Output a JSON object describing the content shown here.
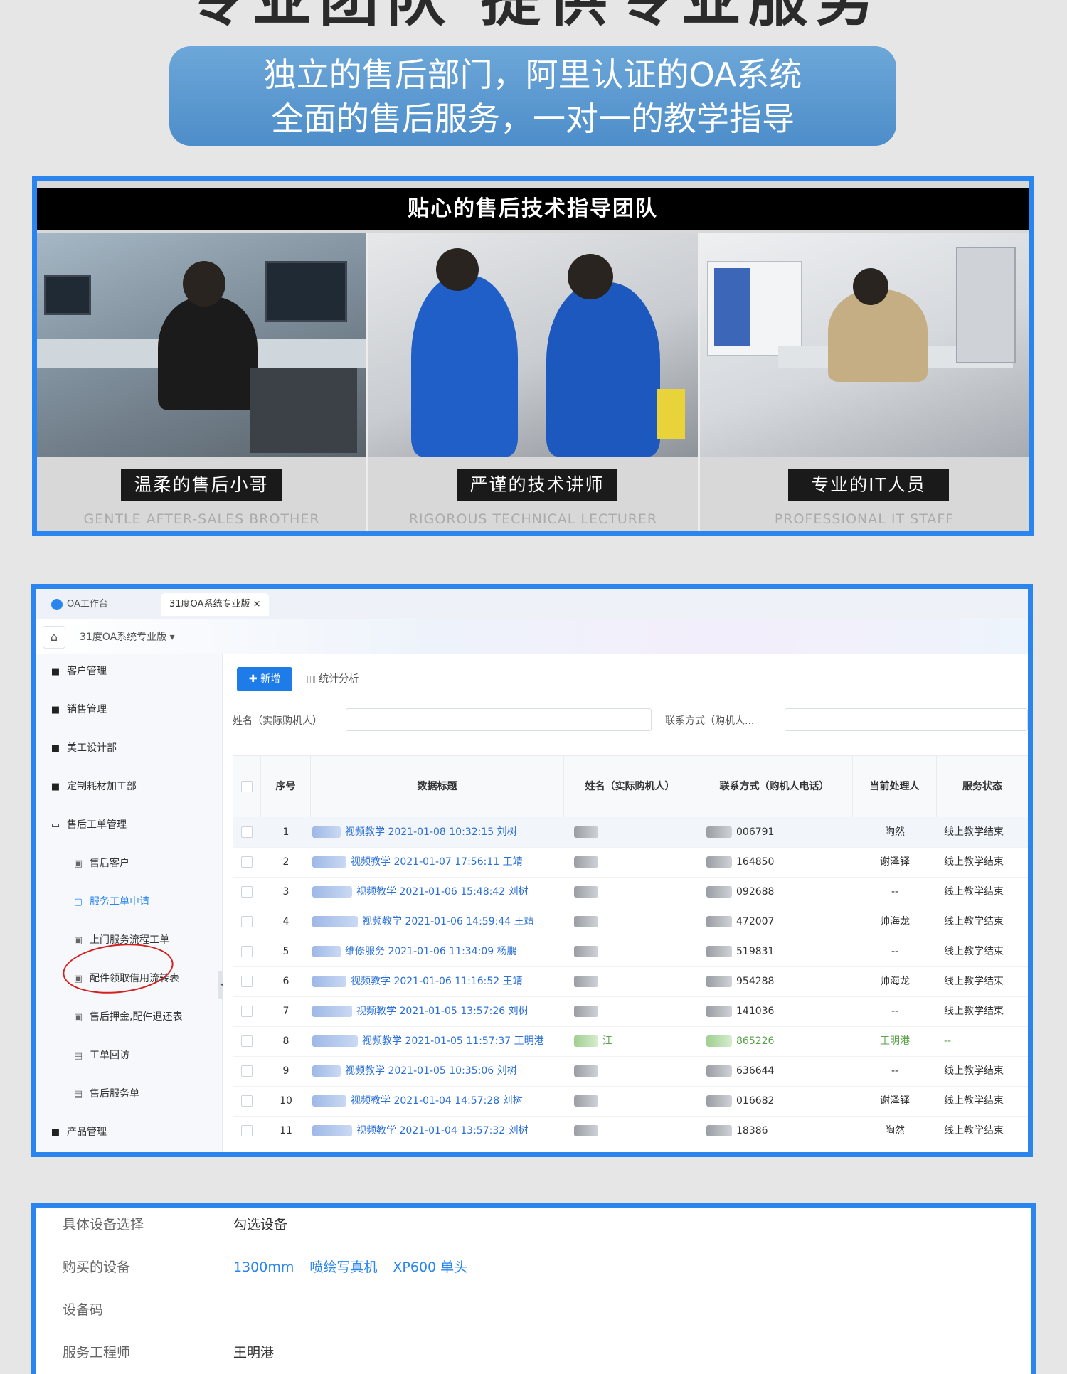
{
  "hero": {
    "title": "专业团队 提供专业服务",
    "line1": "独立的售后部门，阿里认证的OA系统",
    "line2": "全面的售后服务，一对一的教学指导"
  },
  "team": {
    "header": "贴心的售后技术指导团队",
    "members": [
      {
        "cn": "温柔的售后小哥",
        "en": "GENTLE AFTER-SALES BROTHER"
      },
      {
        "cn": "严谨的技术讲师",
        "en": "RIGOROUS TECHNICAL LECTURER"
      },
      {
        "cn": "专业的IT人员",
        "en": "PROFESSIONAL IT STAFF"
      }
    ]
  },
  "oa": {
    "tabs": [
      {
        "label": "OA工作台"
      },
      {
        "label": "31度OA系统专业版 ×"
      }
    ],
    "breadcrumb": "31度OA系统专业版 ▾",
    "home_icon": "⌂",
    "sidebar": [
      {
        "label": "客户管理",
        "icon": "■"
      },
      {
        "label": "销售管理",
        "icon": "■"
      },
      {
        "label": "美工设计部",
        "icon": "■"
      },
      {
        "label": "定制耗材加工部",
        "icon": "■"
      },
      {
        "label": "售后工单管理",
        "icon": "▭"
      },
      {
        "label": "售后客户",
        "icon": "▣"
      },
      {
        "label": "服务工单申请",
        "icon": "▢"
      },
      {
        "label": "上门服务流程工单",
        "icon": "▣"
      },
      {
        "label": "配件领取借用流转表",
        "icon": "▣"
      },
      {
        "label": "售后押金,配件退还表",
        "icon": "▣"
      },
      {
        "label": "工单回访",
        "icon": "▤"
      },
      {
        "label": "售后服务单",
        "icon": "▤"
      },
      {
        "label": "产品管理",
        "icon": "■"
      }
    ],
    "toolbar": {
      "add": "✚ 新增",
      "stats": "统计分析"
    },
    "filters": {
      "name_label": "姓名（实际购机人）",
      "contact_label": "联系方式（购机人..."
    },
    "columns": [
      "序号",
      "数据标题",
      "姓名（实际购机人）",
      "联系方式（购机人电话）",
      "当前处理人",
      "服务状态"
    ],
    "rows": [
      {
        "no": "1",
        "title": "视频教学 2021-01-08 10:32:15 刘树",
        "name_tail": "",
        "phone": "006791",
        "handler": "陶然",
        "status": "线上教学结束"
      },
      {
        "no": "2",
        "title": "视频教学 2021-01-07 17:56:11 王靖",
        "name_tail": "",
        "phone": "164850",
        "handler": "谢泽铎",
        "status": "线上教学结束"
      },
      {
        "no": "3",
        "title": "视频教学 2021-01-06 15:48:42 刘树",
        "name_tail": "",
        "phone": "092688",
        "handler": "--",
        "status": "线上教学结束"
      },
      {
        "no": "4",
        "title": "视频教学 2021-01-06 14:59:44 王靖",
        "name_tail": "",
        "phone": "472007",
        "handler": "帅海龙",
        "status": "线上教学结束"
      },
      {
        "no": "5",
        "title": "维修服务 2021-01-06 11:34:09 杨鹏",
        "name_tail": "",
        "phone": "519831",
        "handler": "--",
        "status": "线上教学结束"
      },
      {
        "no": "6",
        "title": "视频教学 2021-01-06 11:16:52 王靖",
        "name_tail": "",
        "phone": "954288",
        "handler": "帅海龙",
        "status": "线上教学结束"
      },
      {
        "no": "7",
        "title": "视频教学 2021-01-05 13:57:26 刘树",
        "name_tail": "",
        "phone": "141036",
        "handler": "--",
        "status": "线上教学结束"
      },
      {
        "no": "8",
        "title": "视频教学 2021-01-05 11:57:37 王明港",
        "name_tail": "江",
        "phone": "865226",
        "handler": "王明港",
        "status": "--"
      },
      {
        "no": "9",
        "title": "视频教学 2021-01-05 10:35:06 刘树",
        "name_tail": "",
        "phone": "636644",
        "handler": "--",
        "status": "线上教学结束"
      },
      {
        "no": "10",
        "title": "视频教学 2021-01-04 14:57:28 刘树",
        "name_tail": "",
        "phone": "016682",
        "handler": "谢泽铎",
        "status": "线上教学结束"
      },
      {
        "no": "11",
        "title": "视频教学 2021-01-04 13:57:32 刘树",
        "name_tail": "",
        "phone": "18386",
        "handler": "陶然",
        "status": "线上教学结束"
      }
    ]
  },
  "detail": {
    "rows": [
      {
        "label": "具体设备选择",
        "value": "勾选设备"
      },
      {
        "label": "购买的设备",
        "values": [
          "1300mm",
          "喷绘写真机",
          "XP600 单头"
        ]
      },
      {
        "label": "设备码",
        "value": ""
      },
      {
        "label": "服务工程师",
        "value": "王明港"
      }
    ]
  },
  "colors": {
    "accent_blue": "#2a86ee",
    "link_blue": "#2a6fd6",
    "banner_blue": "#5b9ad2",
    "ellipse_red": "#d42020"
  }
}
